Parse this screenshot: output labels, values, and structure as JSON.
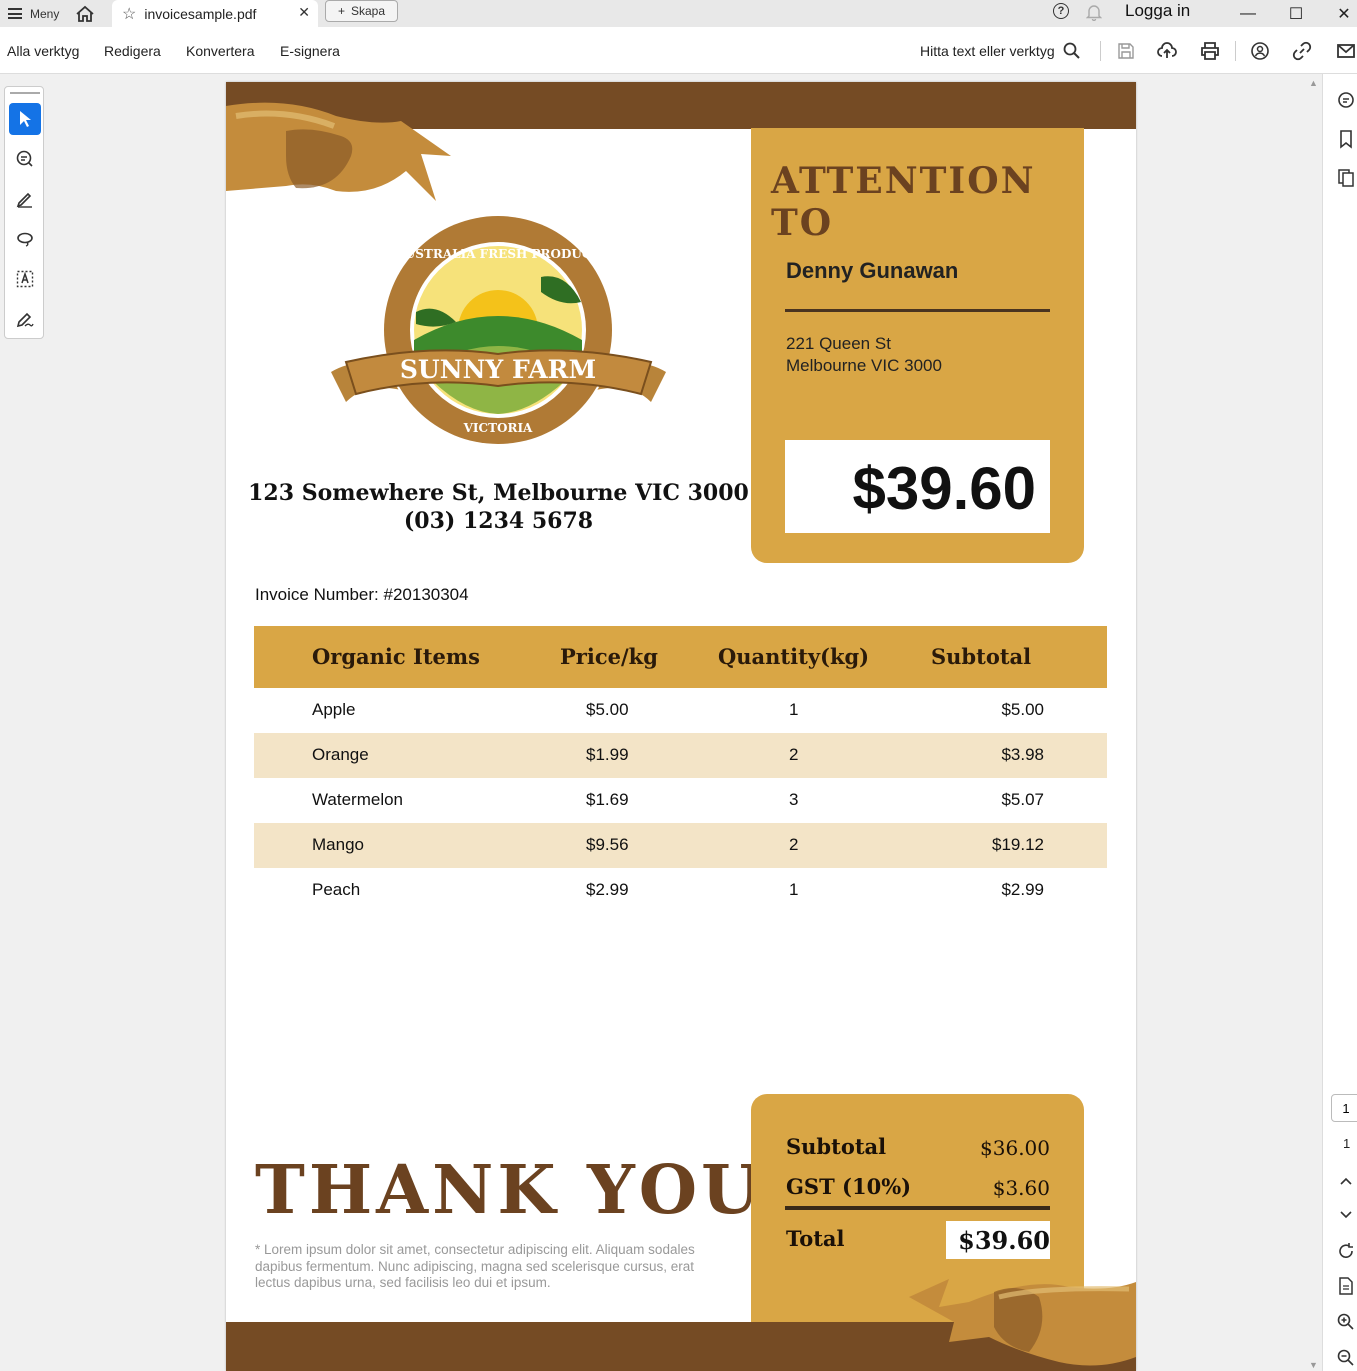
{
  "app": {
    "menu_label": "Meny",
    "tab_title": "invoicesample.pdf",
    "new_label": "Skapa",
    "login_label": "Logga in"
  },
  "toolbar": {
    "all_tools": "Alla verktyg",
    "edit": "Redigera",
    "convert": "Konvertera",
    "esign": "E-signera",
    "search_label": "Hitta text eller verktyg"
  },
  "pager": {
    "current": "1",
    "total": "1"
  },
  "invoice": {
    "attention_title": "ATTENTION TO",
    "customer_name": "Denny Gunawan",
    "customer_addr1": "221 Queen St",
    "customer_addr2": "Melbourne VIC 3000",
    "amount_due": "$39.60",
    "logo_top_text": "AUSTRALIA FRESH PRODUCE",
    "logo_name": "SUNNY FARM",
    "logo_bottom_text": "VICTORIA",
    "company_address": "123 Somewhere St, Melbourne VIC 3000",
    "company_phone": "(03) 1234 5678",
    "invoice_number": "Invoice Number: #20130304",
    "columns": [
      "Organic Items",
      "Price/kg",
      "Quantity(kg)",
      "Subtotal"
    ],
    "rows": [
      [
        "Apple",
        "$5.00",
        "1",
        "$5.00"
      ],
      [
        "Orange",
        "$1.99",
        "2",
        "$3.98"
      ],
      [
        "Watermelon",
        "$1.69",
        "3",
        "$5.07"
      ],
      [
        "Mango",
        "$9.56",
        "2",
        "$19.12"
      ],
      [
        "Peach",
        "$2.99",
        "1",
        "$2.99"
      ]
    ],
    "thank_you": "THANK YOU",
    "lorem": "* Lorem ipsum dolor sit amet, consectetur adipiscing elit. Aliquam sodales dapibus fermentum. Nunc adipiscing, magna sed scelerisque cursus, erat lectus dapibus urna, sed facilisis leo dui et ipsum.",
    "subtotal_label": "Subtotal",
    "subtotal_value": "$36.00",
    "gst_label": "GST (10%)",
    "gst_value": "$3.60",
    "total_label": "Total",
    "total_value": "$39.60"
  },
  "colors": {
    "brown_band": "#754b24",
    "gold": "#d9a645",
    "row_alt": "#f3e4c7",
    "accent_blue": "#1473e6"
  }
}
